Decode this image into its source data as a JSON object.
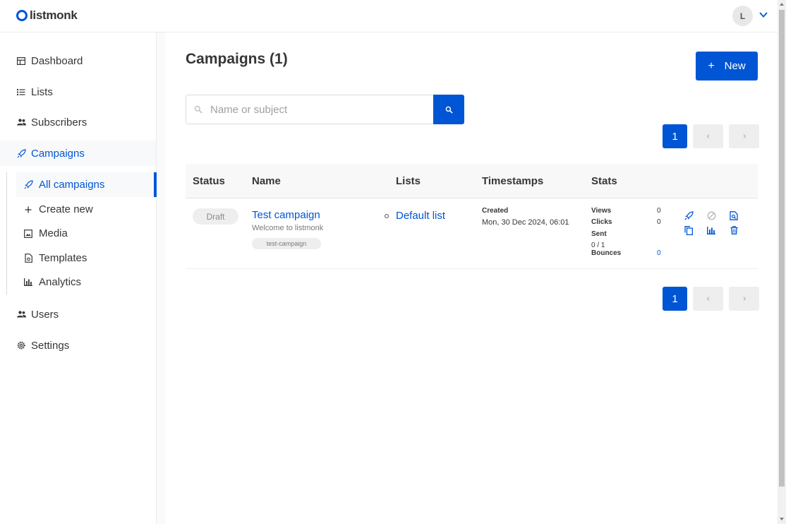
{
  "app": {
    "name": "listmonk"
  },
  "user": {
    "initial": "L"
  },
  "sidebar": {
    "items": [
      {
        "label": "Dashboard",
        "icon": "dashboard-icon"
      },
      {
        "label": "Lists",
        "icon": "list-icon"
      },
      {
        "label": "Subscribers",
        "icon": "people-icon"
      },
      {
        "label": "Campaigns",
        "icon": "rocket-icon",
        "active": true
      },
      {
        "label": "Users",
        "icon": "people-icon"
      },
      {
        "label": "Settings",
        "icon": "gear-icon"
      }
    ],
    "campaigns_sub": [
      {
        "label": "All campaigns",
        "icon": "rocket-icon",
        "active": true
      },
      {
        "label": "Create new",
        "icon": "plus-icon"
      },
      {
        "label": "Media",
        "icon": "image-icon"
      },
      {
        "label": "Templates",
        "icon": "file-icon"
      },
      {
        "label": "Analytics",
        "icon": "chart-icon"
      }
    ]
  },
  "main": {
    "title": "Campaigns (1)",
    "new_button": "New",
    "search": {
      "placeholder": "Name or subject",
      "value": ""
    },
    "pagination": {
      "current": "1"
    },
    "columns": [
      "Status",
      "Name",
      "Lists",
      "Timestamps",
      "Stats"
    ],
    "rows": [
      {
        "status": "Draft",
        "name": "Test campaign",
        "subject": "Welcome to listmonk",
        "tag": "test-campaign",
        "lists": [
          "Default list"
        ],
        "created_label": "Created",
        "created_value": "Mon, 30 Dec 2024, 06:01",
        "stats": {
          "views_label": "Views",
          "views": "0",
          "clicks_label": "Clicks",
          "clicks": "0",
          "sent_label": "Sent",
          "sent": "0 / 1",
          "bounces_label": "Bounces",
          "bounces": "0"
        },
        "actions": [
          "rocket-icon",
          "cancel-icon",
          "preview-icon",
          "clone-icon",
          "analytics-icon",
          "trash-icon"
        ]
      }
    ]
  },
  "colors": {
    "primary": "#0055d4",
    "text": "#363636",
    "muted": "#7a7a7a",
    "tag_bg": "#eeeeee"
  }
}
